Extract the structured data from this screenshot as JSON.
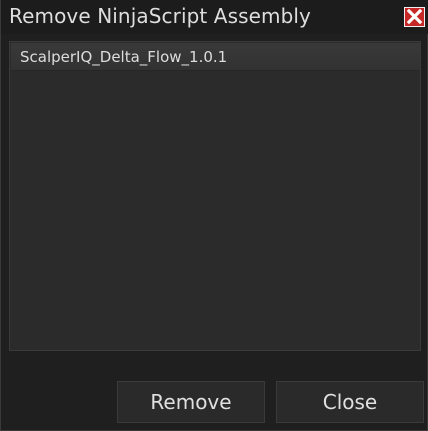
{
  "window": {
    "title": "Remove NinjaScript Assembly",
    "close_icon": "close-icon"
  },
  "assemblies": {
    "items": [
      {
        "label": "ScalperIQ_Delta_Flow_1.0.1"
      }
    ]
  },
  "actions": {
    "remove_label": "Remove",
    "close_label": "Close"
  },
  "colors": {
    "background": "#1f1f1f",
    "panel": "#2b2b2b",
    "selected_row": "#393939",
    "close_icon_red": "#c62828",
    "text": "#dedede"
  }
}
